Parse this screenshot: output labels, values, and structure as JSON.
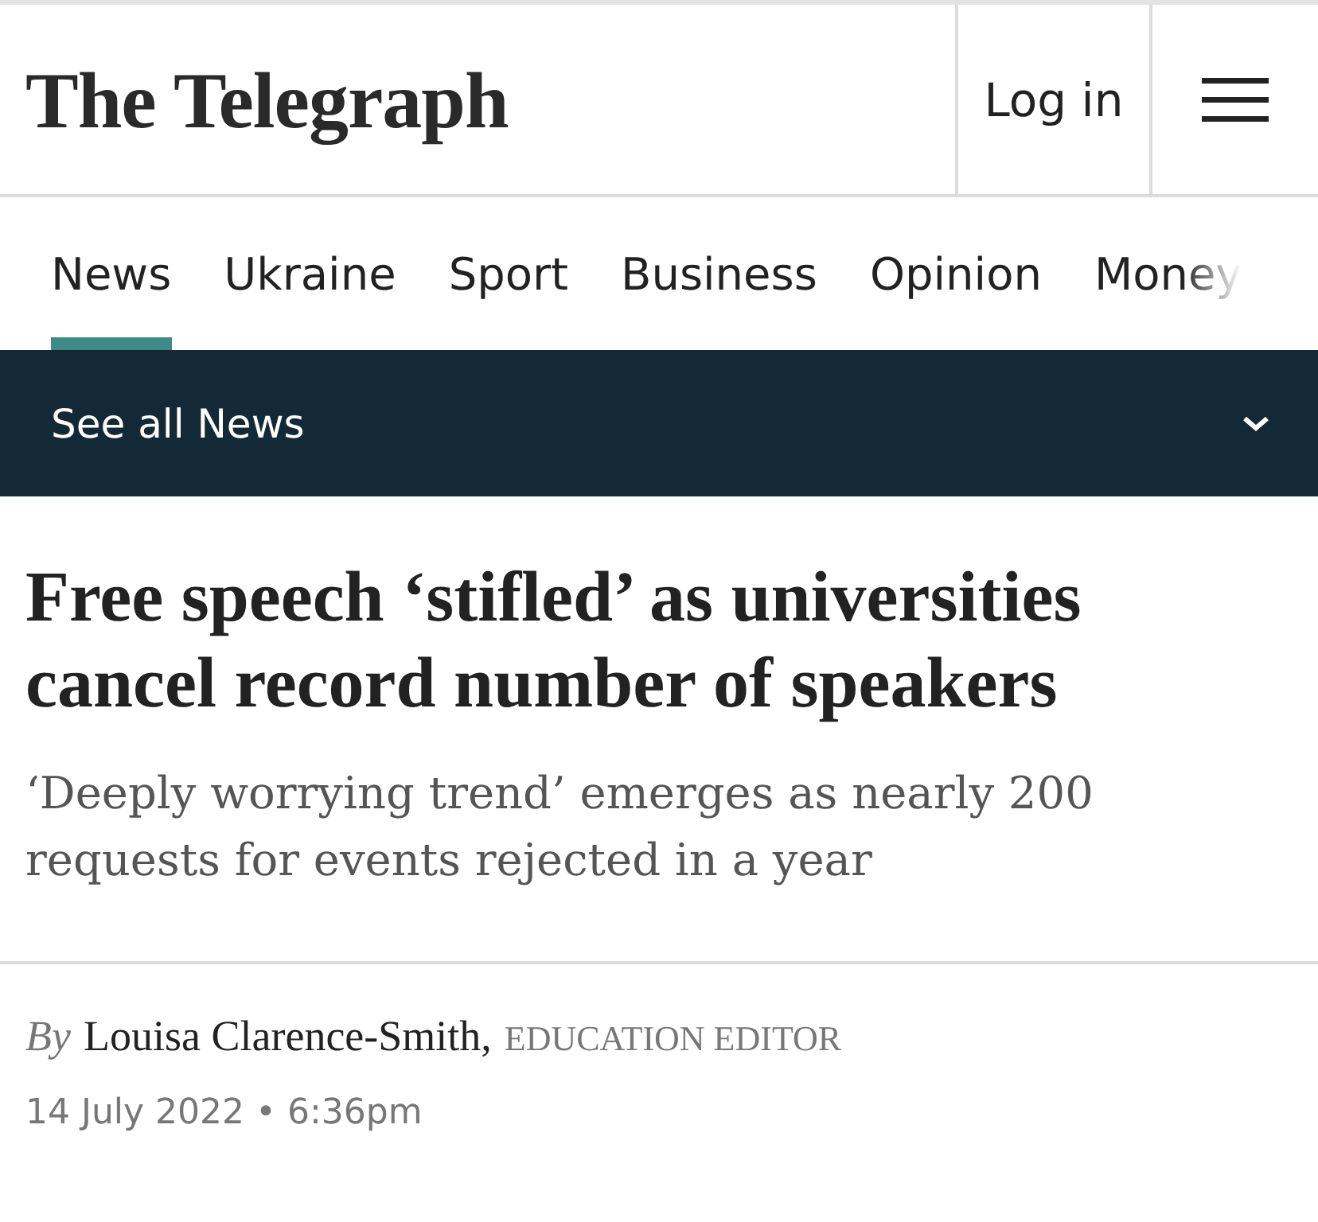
{
  "header": {
    "logo": "The Telegraph",
    "login": "Log in"
  },
  "nav": {
    "tabs": [
      {
        "label": "News",
        "selected": true
      },
      {
        "label": "Ukraine",
        "selected": false
      },
      {
        "label": "Sport",
        "selected": false
      },
      {
        "label": "Business",
        "selected": false
      },
      {
        "label": "Opinion",
        "selected": false
      },
      {
        "label": "Money",
        "selected": false
      }
    ]
  },
  "section_bar": {
    "label": "See all News",
    "expanded": false
  },
  "article": {
    "headline": "Free speech ‘stifled’ as universities cancel record number of speakers",
    "standfirst": "‘Deeply worrying trend’ emerges as nearly 200 requests for events rejected in a year",
    "byline": {
      "by": "By",
      "author": "Louisa Clarence-Smith,",
      "role": "EDUCATION EDITOR"
    },
    "date": "14 July 2022 • 6:36pm"
  }
}
